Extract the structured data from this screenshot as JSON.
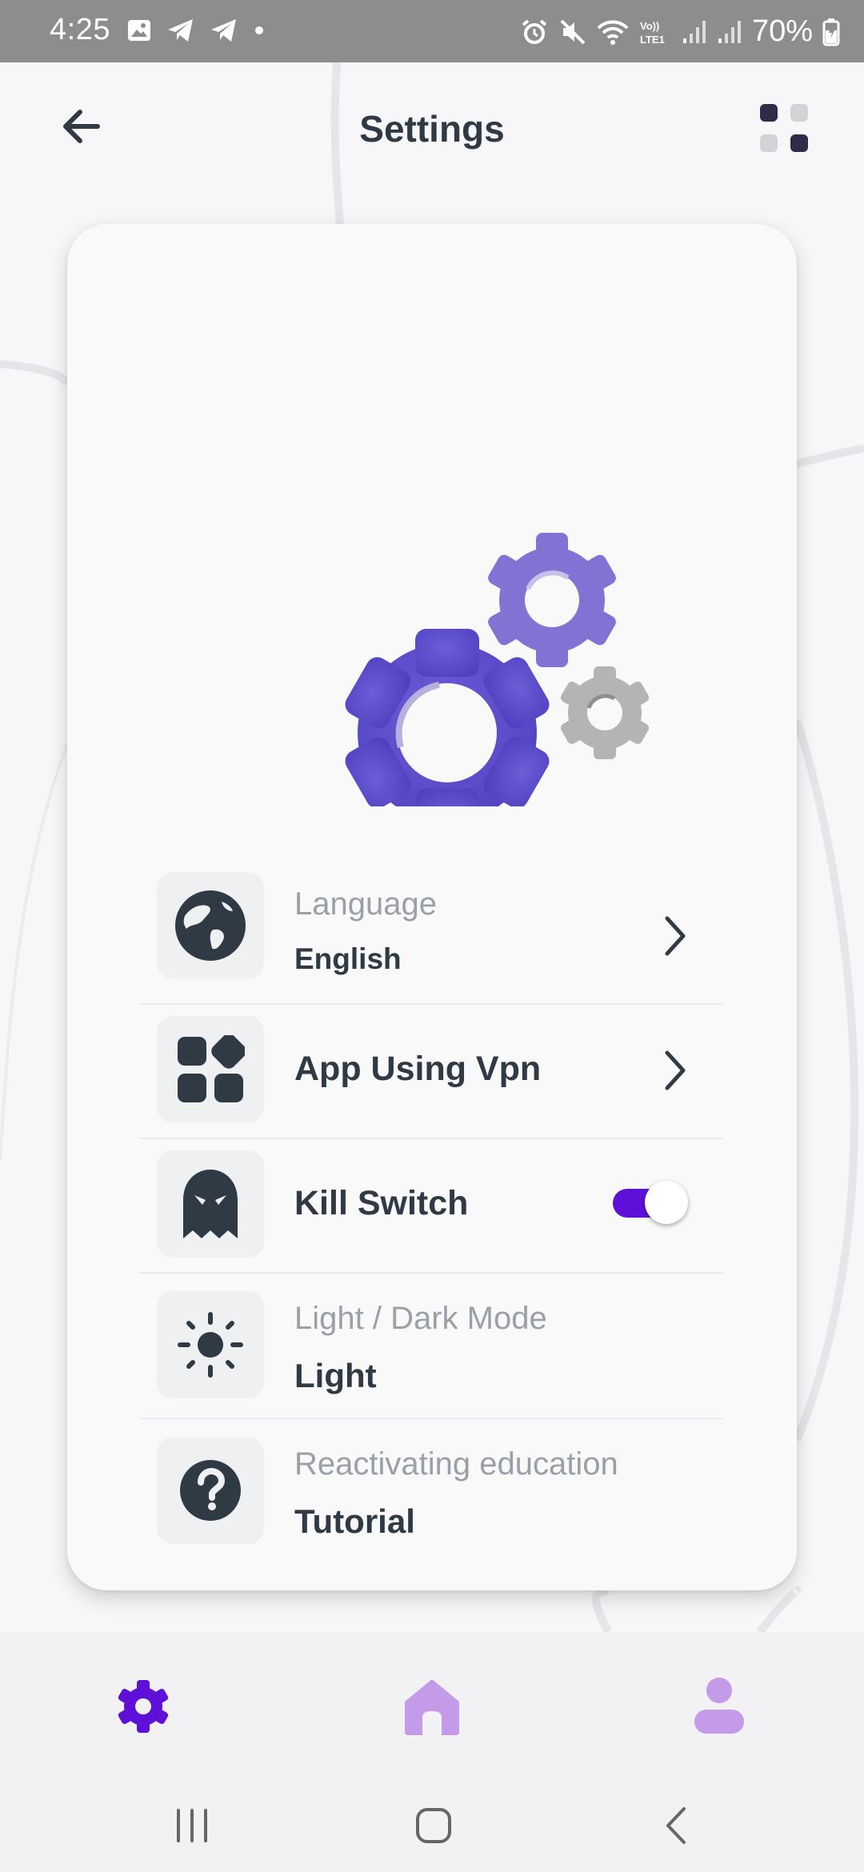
{
  "status_bar": {
    "time": "4:25",
    "battery_text": "70%",
    "left_icons": [
      "gallery-icon",
      "telegram-icon",
      "telegram-icon",
      "dot-icon"
    ],
    "right_icons": [
      "alarm-icon",
      "mute-icon",
      "wifi-icon",
      "volte-lte1-icon",
      "signal-icon",
      "signal-icon",
      "battery-icon"
    ]
  },
  "header": {
    "title": "Settings",
    "back_icon": "arrow-left-icon",
    "menu_icon": "grid-dots-icon"
  },
  "illustration": {
    "icon": "gears-illustration"
  },
  "settings": {
    "items": [
      {
        "key": "language",
        "icon": "globe-icon",
        "label": "Language",
        "value": "English",
        "control": "chevron"
      },
      {
        "key": "apps",
        "icon": "apps-icon",
        "label": "App Using Vpn",
        "control": "chevron"
      },
      {
        "key": "kill_switch",
        "icon": "ghost-icon",
        "label": "Kill Switch",
        "control": "toggle",
        "toggle_on": true
      },
      {
        "key": "theme",
        "icon": "sun-icon",
        "label": "Light / Dark Mode",
        "value": "Light"
      },
      {
        "key": "tutorial",
        "icon": "question-icon",
        "label": "Reactivating education",
        "value": "Tutorial"
      }
    ]
  },
  "bottom_nav": {
    "items": [
      {
        "icon": "settings-gear-icon",
        "active": true
      },
      {
        "icon": "home-icon",
        "active": false
      },
      {
        "icon": "profile-icon",
        "active": false
      }
    ]
  },
  "colors": {
    "accent": "#5f10d8",
    "gear_primary": "#5e4fcb",
    "gear_secondary": "#8073d4",
    "gear_gray": "#b4b4b4",
    "nav_inactive": "#c39be8",
    "text_dark": "#2f3a45",
    "text_muted": "#9aa0a8"
  },
  "system_nav": {
    "recent": "recents-icon",
    "home": "home-circle-icon",
    "back": "back-chevron-icon"
  }
}
